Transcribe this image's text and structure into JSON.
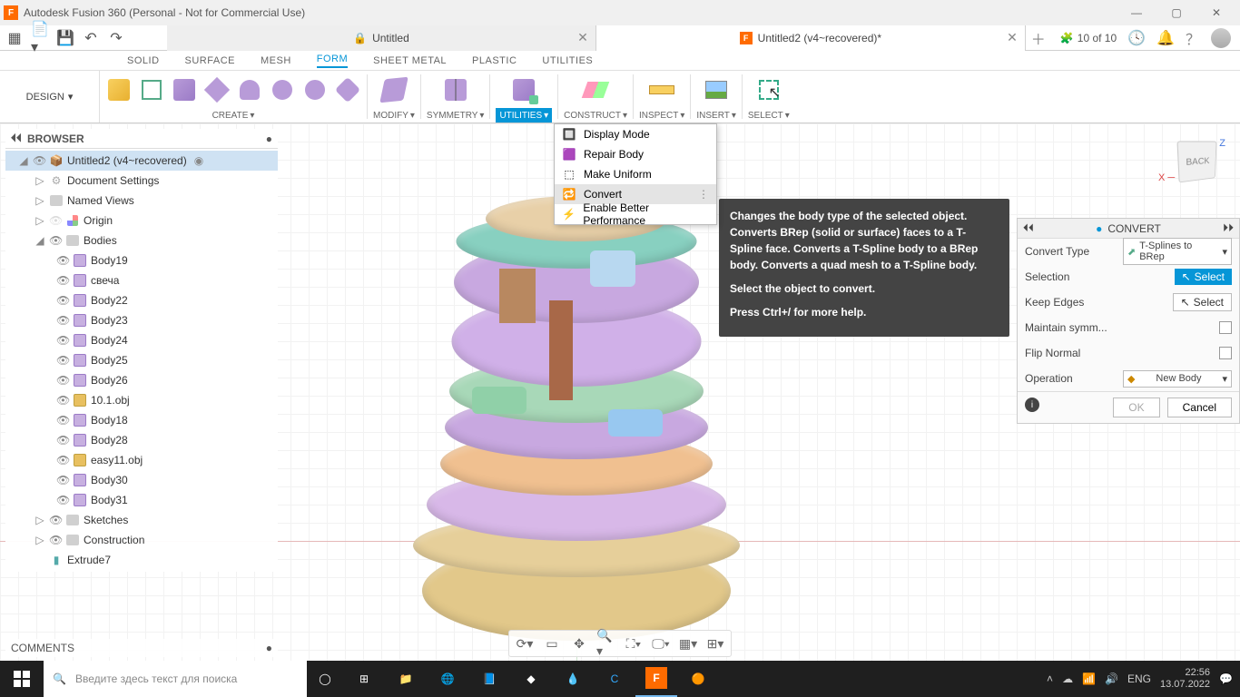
{
  "titlebar": {
    "title": "Autodesk Fusion 360 (Personal - Not for Commercial Use)"
  },
  "tabs": {
    "t1": "Untitled",
    "t2": "Untitled2 (v4~recovered)*"
  },
  "ext_status": "10 of 10",
  "ribbon": {
    "tabs": {
      "solid": "SOLID",
      "surface": "SURFACE",
      "mesh": "MESH",
      "form": "FORM",
      "sheet": "SHEET METAL",
      "plastic": "PLASTIC",
      "utilities": "UTILITIES"
    },
    "design": "DESIGN",
    "groups": {
      "create": "CREATE",
      "modify": "MODIFY",
      "symmetry": "SYMMETRY",
      "utilities": "UTILITIES",
      "construct": "CONSTRUCT",
      "inspect": "INSPECT",
      "insert": "INSERT",
      "select": "SELECT"
    }
  },
  "browser": {
    "title": "BROWSER",
    "root": "Untitled2 (v4~recovered)",
    "items": {
      "docset": "Document Settings",
      "named": "Named Views",
      "origin": "Origin",
      "bodies": "Bodies",
      "b": [
        "Body19",
        "свеча",
        "Body22",
        "Body23",
        "Body24",
        "Body25",
        "Body26",
        "10.1.obj",
        "Body18",
        "Body28",
        "easy11.obj",
        "Body30",
        "Body31"
      ],
      "sketches": "Sketches",
      "construction": "Construction",
      "extrude": "Extrude7"
    }
  },
  "dropdown": {
    "display": "Display Mode",
    "repair": "Repair Body",
    "uniform": "Make Uniform",
    "convert": "Convert",
    "perf": "Enable Better Performance"
  },
  "tooltip": {
    "p1": "Changes the body type of the selected object. Converts BRep (solid or surface) faces to a T-Spline face. Converts a T-Spline body to a BRep body. Converts a quad mesh to a T-Spline body.",
    "p2": "Select the object to convert.",
    "p3": "Press Ctrl+/ for more help."
  },
  "convert": {
    "title": "CONVERT",
    "type_lbl": "Convert Type",
    "type_val": "T-Splines to BRep",
    "sel_lbl": "Selection",
    "sel_btn": "Select",
    "keep_lbl": "Keep Edges",
    "keep_btn": "Select",
    "symm_lbl": "Maintain symm...",
    "flip_lbl": "Flip Normal",
    "op_lbl": "Operation",
    "op_val": "New Body",
    "ok": "OK",
    "cancel": "Cancel"
  },
  "comments": "COMMENTS",
  "viewcube": "BACK",
  "taskbar": {
    "search_ph": "Введите здесь текст для поиска",
    "lang": "ENG",
    "time": "22:56",
    "date": "13.07.2022"
  }
}
